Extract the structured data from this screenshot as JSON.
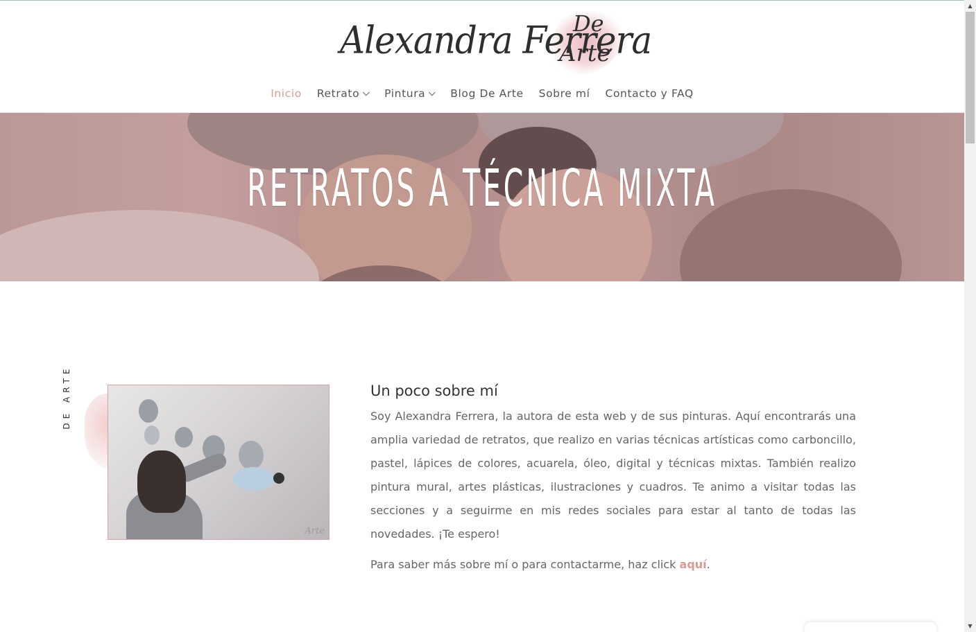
{
  "logo": {
    "main": "Alexandra Ferrera",
    "de": "De",
    "arte": "Arte"
  },
  "nav": {
    "items": [
      {
        "label": "Inicio",
        "active": true,
        "dropdown": false
      },
      {
        "label": "Retrato",
        "active": false,
        "dropdown": true
      },
      {
        "label": "Pintura",
        "active": false,
        "dropdown": true
      },
      {
        "label": "Blog De Arte",
        "active": false,
        "dropdown": false
      },
      {
        "label": "Sobre mí",
        "active": false,
        "dropdown": false
      },
      {
        "label": "Contacto y FAQ",
        "active": false,
        "dropdown": false
      }
    ]
  },
  "hero": {
    "title": "RETRATOS A TÉCNICA MIXTA"
  },
  "section": {
    "vertical_label": "DE ARTE",
    "photo_watermark": "Arte",
    "heading": "Un poco sobre mí",
    "body": "Soy Alexandra Ferrera, la autora de esta web y de sus pinturas. Aquí encontrarás una amplia variedad de retratos, que realizo en varias técnicas artísticas como carboncillo, pastel, lápices de colores, acuarela, óleo, digital y técnicas mixtas. También realizo pintura mural, artes plásticas, ilustraciones y cuadros. Te animo a visitar todas las secciones y a seguirme en mis redes sociales para estar al tanto de todas las novedades. ¡Te espero!",
    "more_prefix": "Para saber más sobre mí o para contactarme, haz click ",
    "more_link": "aquí",
    "more_suffix": "."
  },
  "colors": {
    "accent": "#d99a94",
    "hero_tint": "#c49696",
    "text": "#666666",
    "heading": "#333333"
  }
}
